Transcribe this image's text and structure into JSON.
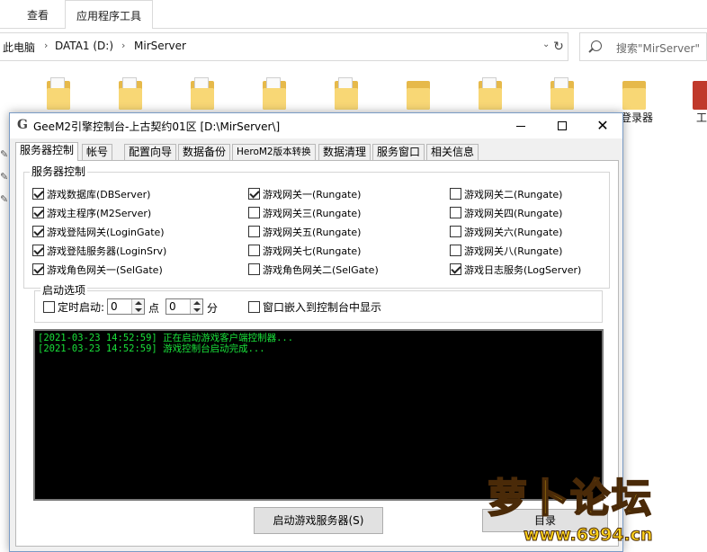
{
  "explorer": {
    "ribbon_tabs": [
      "查看",
      "应用程序工具"
    ],
    "breadcrumb": [
      "此电脑",
      "DATA1 (D:)",
      "MirServer"
    ],
    "search_placeholder": "搜索\"MirServer\"",
    "folder_labels": [
      "登录器",
      "工"
    ]
  },
  "window": {
    "title": "GeeM2引擎控制台-上古契约01区 [D:\\MirServer\\]",
    "icon_glyph": "G"
  },
  "tabs": [
    "服务器控制",
    "帐号",
    "配置向导",
    "数据备份",
    "HeroM2版本转换",
    "数据清理",
    "服务窗口",
    "相关信息"
  ],
  "server_group": {
    "title": "服务器控制",
    "checkboxes": [
      {
        "label": "游戏数据库(DBServer)",
        "checked": true
      },
      {
        "label": "游戏主程序(M2Server)",
        "checked": true
      },
      {
        "label": "游戏登陆网关(LoginGate)",
        "checked": true
      },
      {
        "label": "游戏登陆服务器(LoginSrv)",
        "checked": true
      },
      {
        "label": "游戏角色网关一(SelGate)",
        "checked": true
      },
      {
        "label": "游戏网关一(Rungate)",
        "checked": true
      },
      {
        "label": "游戏网关三(Rungate)",
        "checked": false
      },
      {
        "label": "游戏网关五(Rungate)",
        "checked": false
      },
      {
        "label": "游戏网关七(Rungate)",
        "checked": false
      },
      {
        "label": "游戏角色网关二(SelGate)",
        "checked": false
      },
      {
        "label": "游戏网关二(Rungate)",
        "checked": false
      },
      {
        "label": "游戏网关四(Rungate)",
        "checked": false
      },
      {
        "label": "游戏网关六(Rungate)",
        "checked": false
      },
      {
        "label": "游戏网关八(Rungate)",
        "checked": false
      },
      {
        "label": "游戏日志服务(LogServer)",
        "checked": true
      }
    ]
  },
  "start_options": {
    "title": "启动选项",
    "timed_start_label": "定时启动:",
    "hour_value": "0",
    "hour_unit": "点",
    "minute_value": "0",
    "minute_unit": "分",
    "embed_label": "窗口嵌入到控制台中显示"
  },
  "log": [
    "[2021-03-23 14:52:59] 正在启动游戏客户端控制器...",
    "[2021-03-23 14:52:59] 游戏控制台启动完成..."
  ],
  "buttons": {
    "start": "启动游戏服务器(S)",
    "second": "目录"
  },
  "watermark": {
    "text": "萝卜论坛",
    "url": "www.6994.cn"
  },
  "colors": {
    "log_text": "#19e23a",
    "console_bg": "#000000",
    "watermark": "#ffd21a"
  }
}
